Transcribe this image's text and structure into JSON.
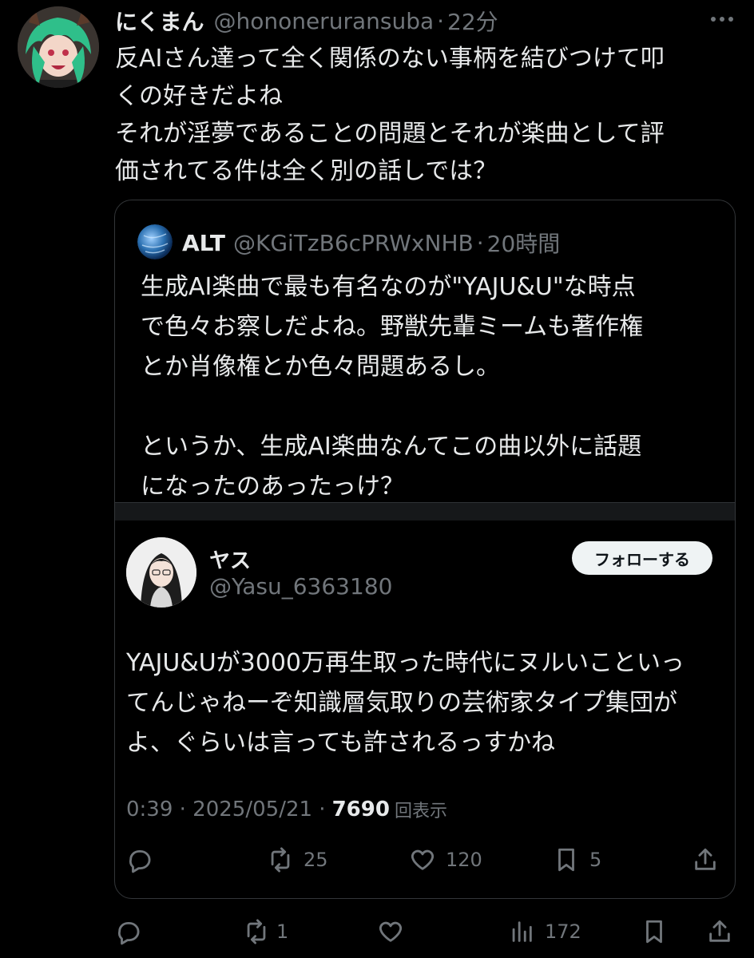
{
  "tweet": {
    "display_name": "にくまん",
    "handle": "@hononeruransuba",
    "separator": "·",
    "time": "22分",
    "text_lines": [
      "反AIさん達って全く関係のない事柄を結びつけて叩",
      "くの好きだよね",
      "それが淫夢であることの問題とそれが楽曲として評",
      "価されてる件は全く別の話しでは？"
    ],
    "stats": {
      "retweets": "1",
      "views": "172"
    }
  },
  "quote": {
    "display_name": "ALT",
    "handle": "@KGiTzB6cPRWxNHB",
    "separator": "·",
    "time": "20時間",
    "text_lines": [
      "生成AI楽曲で最も有名なのが\"YAJU&U\"な時点",
      "で色々お察しだよね。野獣先輩ミームも著作権",
      "とか肖像権とか色々問題あるし。",
      "",
      "というか、生成AI楽曲なんてこの曲以外に話題",
      "になったのあったっけ？"
    ]
  },
  "embedded": {
    "display_name": "ヤス",
    "handle": "@Yasu_6363180",
    "follow_label": "フォローする",
    "text_lines": [
      "YAJU&Uが3000万再生取った時代にヌルいこといっ",
      "てんじゃねーぞ知識層気取りの芸術家タイプ集団が",
      "よ、ぐらいは言っても許されるっすかね"
    ],
    "timestamp": "0:39 · 2025/05/21 ·",
    "views": "7690",
    "views_label": "回表示",
    "stats": {
      "retweets": "25",
      "likes": "120",
      "bookmarks": "5"
    }
  },
  "icons": {
    "more": "more-icon",
    "reply": "reply-icon",
    "retweet": "retweet-icon",
    "like": "heart-icon",
    "views": "views-icon",
    "bookmark": "bookmark-icon",
    "share": "share-icon"
  },
  "colors": {
    "background": "#000000",
    "text": "#e7e9ea",
    "secondary": "#71767b",
    "border": "#333639"
  }
}
